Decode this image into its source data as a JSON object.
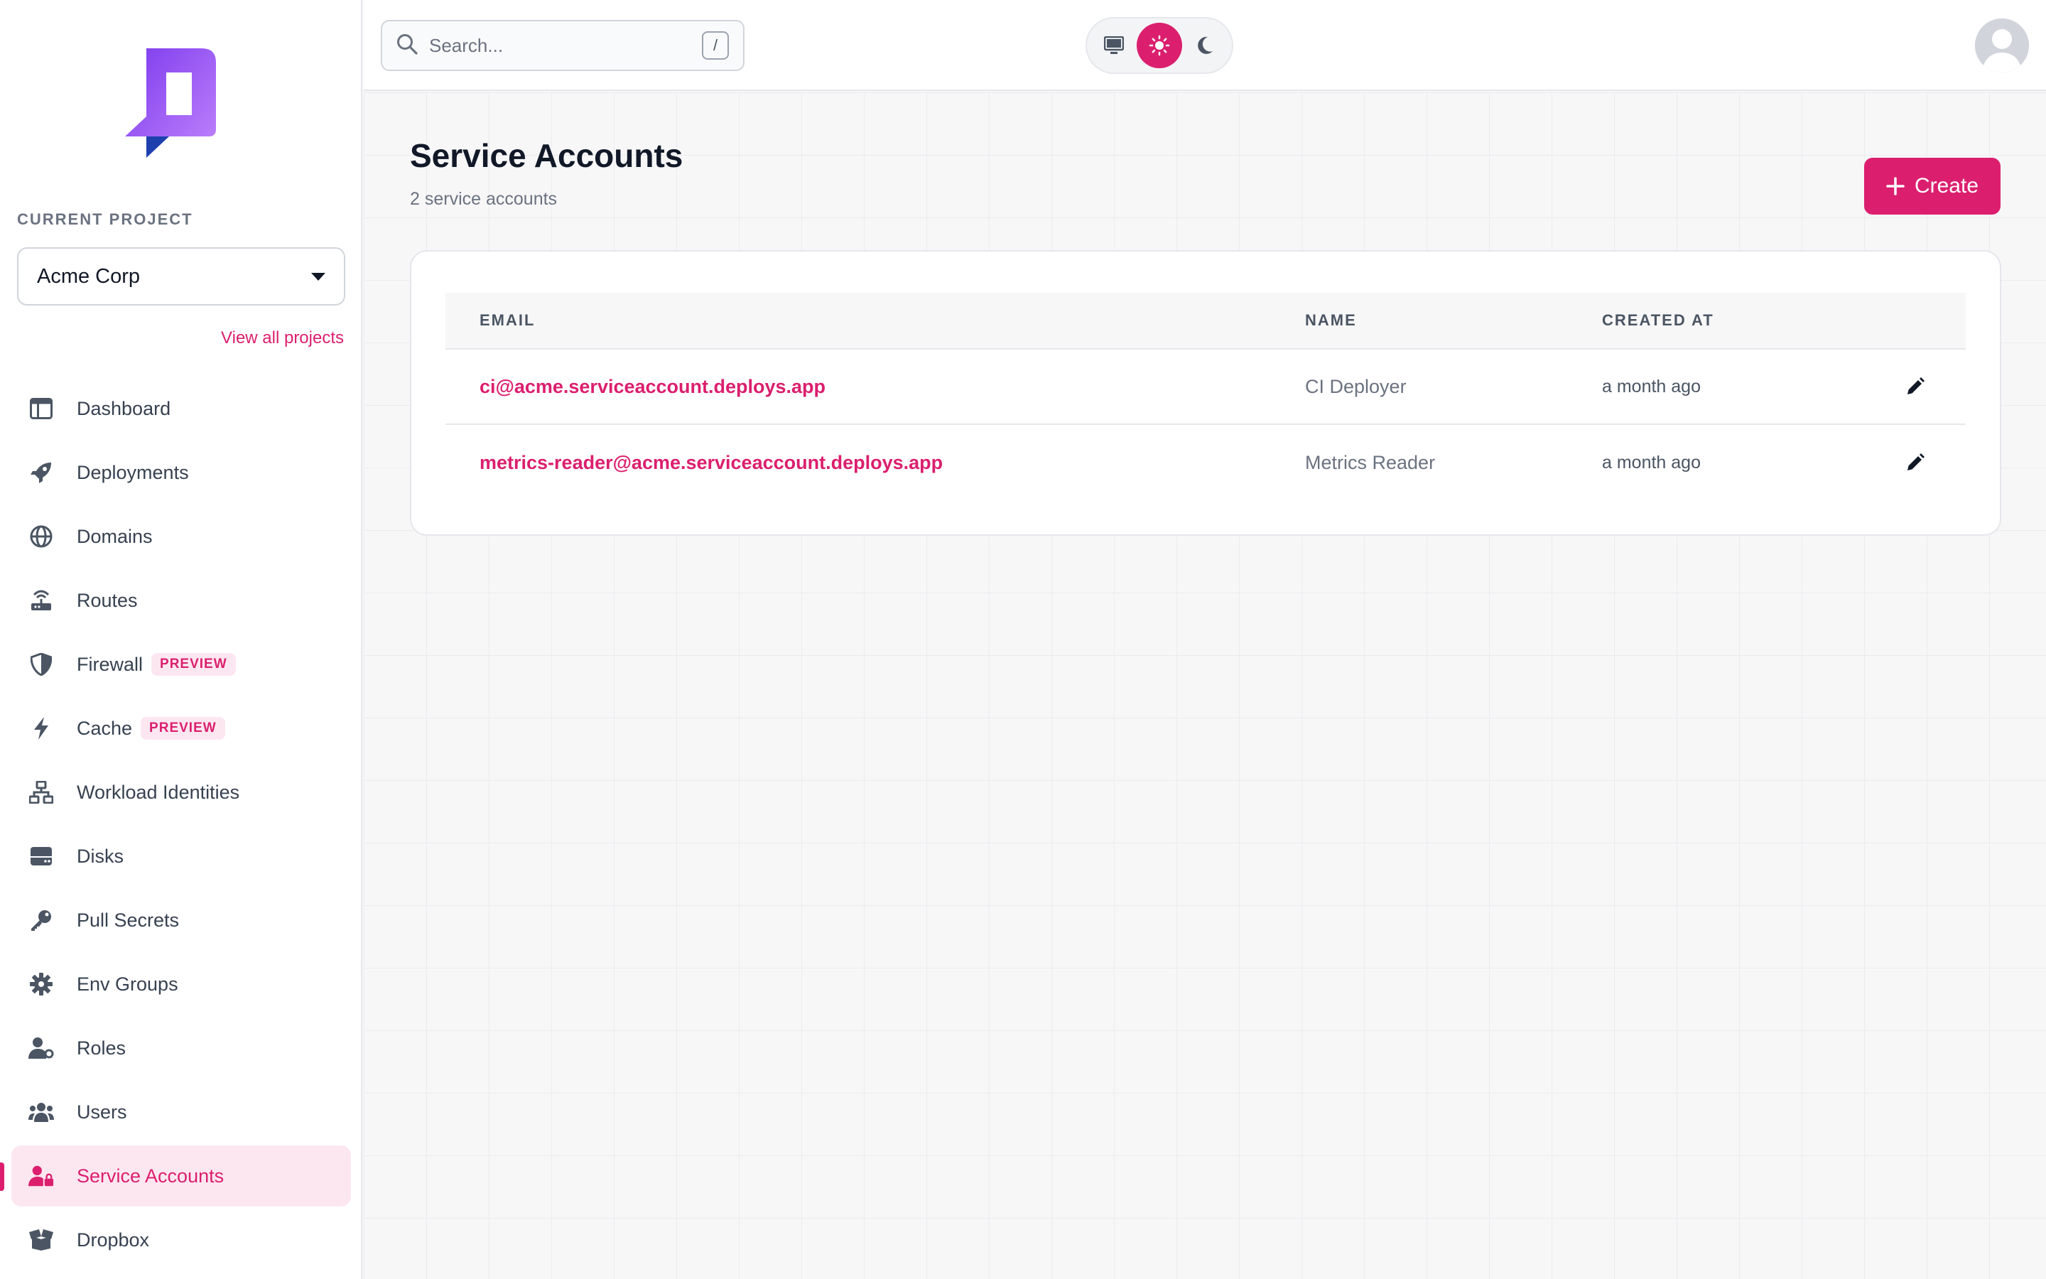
{
  "sidebar": {
    "project_label": "CURRENT PROJECT",
    "project_name": "Acme Corp",
    "view_all": "View all projects",
    "items": [
      {
        "label": "Dashboard",
        "icon": "dashboard-icon"
      },
      {
        "label": "Deployments",
        "icon": "rocket-icon"
      },
      {
        "label": "Domains",
        "icon": "globe-icon"
      },
      {
        "label": "Routes",
        "icon": "router-icon"
      },
      {
        "label": "Firewall",
        "icon": "shield-icon",
        "badge": "PREVIEW"
      },
      {
        "label": "Cache",
        "icon": "bolt-icon",
        "badge": "PREVIEW"
      },
      {
        "label": "Workload Identities",
        "icon": "network-icon"
      },
      {
        "label": "Disks",
        "icon": "disk-icon"
      },
      {
        "label": "Pull Secrets",
        "icon": "key-icon"
      },
      {
        "label": "Env Groups",
        "icon": "gear-icon"
      },
      {
        "label": "Roles",
        "icon": "user-role-icon"
      },
      {
        "label": "Users",
        "icon": "users-icon"
      },
      {
        "label": "Service Accounts",
        "icon": "user-lock-icon",
        "active": true
      },
      {
        "label": "Dropbox",
        "icon": "box-icon"
      }
    ]
  },
  "header": {
    "search_placeholder": "Search...",
    "search_shortcut": "/",
    "theme_selected": "light"
  },
  "main": {
    "title": "Service Accounts",
    "subtitle": "2 service accounts",
    "create_label": "Create",
    "table": {
      "columns": [
        "EMAIL",
        "NAME",
        "CREATED AT"
      ],
      "rows": [
        {
          "email": "ci@acme.serviceaccount.deploys.app",
          "name": "CI Deployer",
          "created": "a month ago"
        },
        {
          "email": "metrics-reader@acme.serviceaccount.deploys.app",
          "name": "Metrics Reader",
          "created": "a month ago"
        }
      ]
    }
  },
  "colors": {
    "accent": "#db1f6e",
    "accent_soft": "#fce7f1",
    "logo_purple": "#8b5cf6",
    "logo_blue": "#1e40af"
  }
}
